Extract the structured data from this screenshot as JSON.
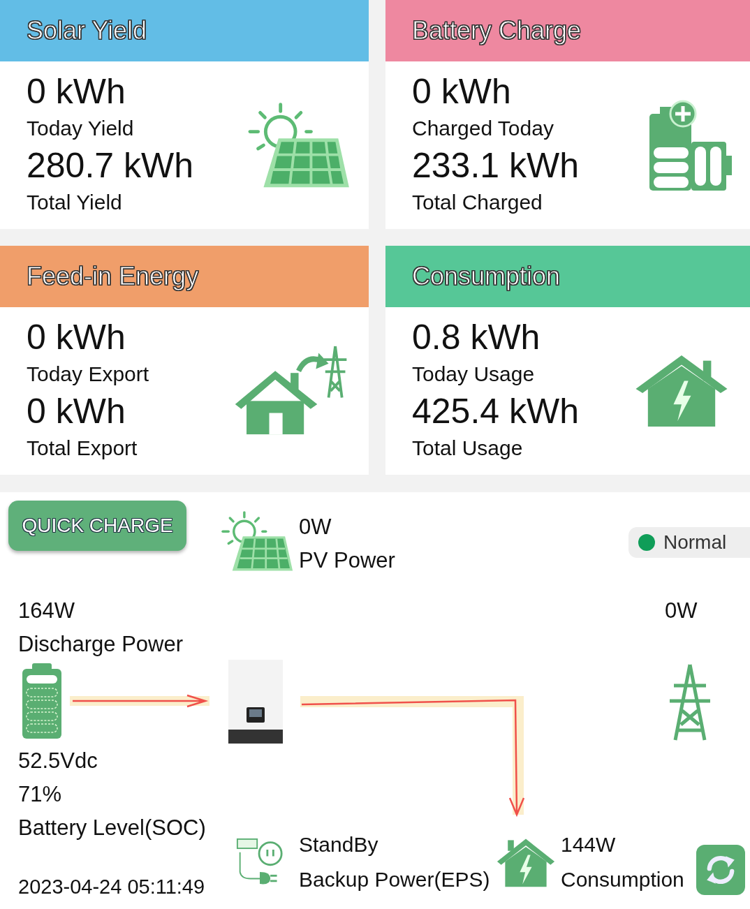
{
  "cards": [
    {
      "title": "Solar Yield",
      "color": "#62bde6",
      "kind": "solar",
      "today_value": "0 kWh",
      "today_label": "Today Yield",
      "total_value": "280.7 kWh",
      "total_label": "Total Yield"
    },
    {
      "title": "Battery Charge",
      "color": "#ee88a0",
      "kind": "battery",
      "today_value": "0 kWh",
      "today_label": "Charged Today",
      "total_value": "233.1 kWh",
      "total_label": "Total Charged"
    },
    {
      "title": "Feed-in Energy",
      "color": "#f09e6a",
      "kind": "export",
      "today_value": "0 kWh",
      "today_label": "Today Export",
      "total_value": "0 kWh",
      "total_label": "Total Export"
    },
    {
      "title": "Consumption",
      "color": "#56c797",
      "kind": "home",
      "today_value": "0.8 kWh",
      "today_label": "Today Usage",
      "total_value": "425.4 kWh",
      "total_label": "Total Usage"
    }
  ],
  "flow": {
    "quick_charge_button": "QUICK CHARGE",
    "pv": {
      "value": "0W",
      "label": "PV Power"
    },
    "status": {
      "label": "Normal",
      "color": "#0f9d58"
    },
    "battery": {
      "power": "164W",
      "power_label": "Discharge Power",
      "voltage": "52.5Vdc",
      "soc": "71%",
      "soc_label": "Battery Level(SOC)"
    },
    "grid": {
      "power": "0W"
    },
    "eps": {
      "status": "StandBy",
      "label": "Backup Power(EPS)"
    },
    "consumption": {
      "power": "144W",
      "label": "Consumption"
    },
    "timestamp": "2023-04-24 05:11:49"
  }
}
